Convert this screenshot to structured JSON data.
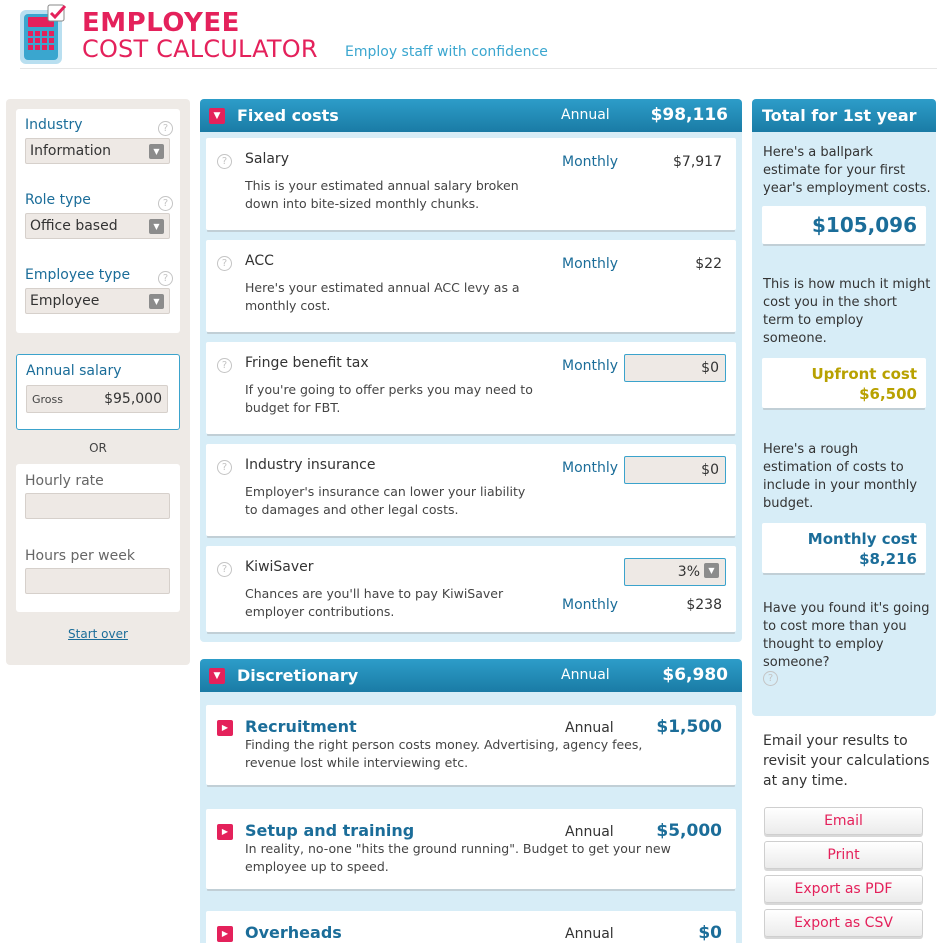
{
  "header": {
    "title_line1": "EMPLOYEE",
    "title_line2": "COST CALCULATOR",
    "tagline": "Employ staff with confidence"
  },
  "sidebar": {
    "industry": {
      "label": "Industry",
      "value": "Information"
    },
    "role_type": {
      "label": "Role type",
      "value": "Office based"
    },
    "employee_type": {
      "label": "Employee type",
      "value": "Employee"
    },
    "annual_salary": {
      "label": "Annual salary",
      "prefix": "Gross",
      "value": "$95,000"
    },
    "or_label": "OR",
    "hourly_rate": {
      "label": "Hourly rate",
      "value": ""
    },
    "hours_per_week": {
      "label": "Hours per week",
      "value": ""
    },
    "start_over": "Start over"
  },
  "fixed_costs": {
    "title": "Fixed costs",
    "period": "Annual",
    "total": "$98,116",
    "rows": [
      {
        "title": "Salary",
        "desc": "This is your estimated annual salary broken down into bite-sized monthly chunks.",
        "period": "Monthly",
        "value": "$7,917"
      },
      {
        "title": "ACC",
        "desc": "Here's your estimated annual ACC levy as a monthly cost.",
        "period": "Monthly",
        "value": "$22"
      },
      {
        "title": "Fringe benefit tax",
        "desc": "If you're going to offer perks you may need to budget for FBT.",
        "period": "Monthly",
        "input_value": "$0"
      },
      {
        "title": "Industry insurance",
        "desc": "Employer's insurance can lower your liability to damages and other legal costs.",
        "period": "Monthly",
        "input_value": "$0"
      },
      {
        "title": "KiwiSaver",
        "desc": "Chances are you'll have to pay KiwiSaver employer contributions.",
        "select_value": "3%",
        "period": "Monthly",
        "value": "$238"
      }
    ]
  },
  "discretionary": {
    "title": "Discretionary",
    "period": "Annual",
    "total": "$6,980",
    "rows": [
      {
        "title": "Recruitment",
        "period": "Annual",
        "value": "$1,500",
        "desc": "Finding the right person costs money. Advertising, agency fees, revenue lost while interviewing etc."
      },
      {
        "title": "Setup and training",
        "period": "Annual",
        "value": "$5,000",
        "desc": "In reality, no-one \"hits the ground running\". Budget to get your new employee up to speed."
      },
      {
        "title": "Overheads",
        "period": "Annual",
        "value": "$0"
      }
    ]
  },
  "summary": {
    "title": "Total for 1st year",
    "first_year_text": "Here's a ballpark estimate for your first year's employment costs.",
    "first_year_value": "$105,096",
    "upfront_text": "This is how much it might cost you in the short term to employ someone.",
    "upfront_label": "Upfront cost",
    "upfront_value": "$6,500",
    "monthly_text": "Here's a rough estimation of costs to include in your monthly budget.",
    "monthly_label": "Monthly cost",
    "monthly_value": "$8,216",
    "found_text": "Have you found it's going to cost more than you thought to employ someone?"
  },
  "export": {
    "text": "Email your results to revisit your calculations at any time.",
    "email": "Email",
    "print": "Print",
    "pdf": "Export as PDF",
    "csv": "Export as CSV"
  },
  "colors": {
    "brand_pink": "#e4215b",
    "brand_blue": "#1b6d99",
    "header_blue": "#2d9dc9",
    "panel_blue": "#d7edf7",
    "upfront_gold": "#b8a100"
  }
}
